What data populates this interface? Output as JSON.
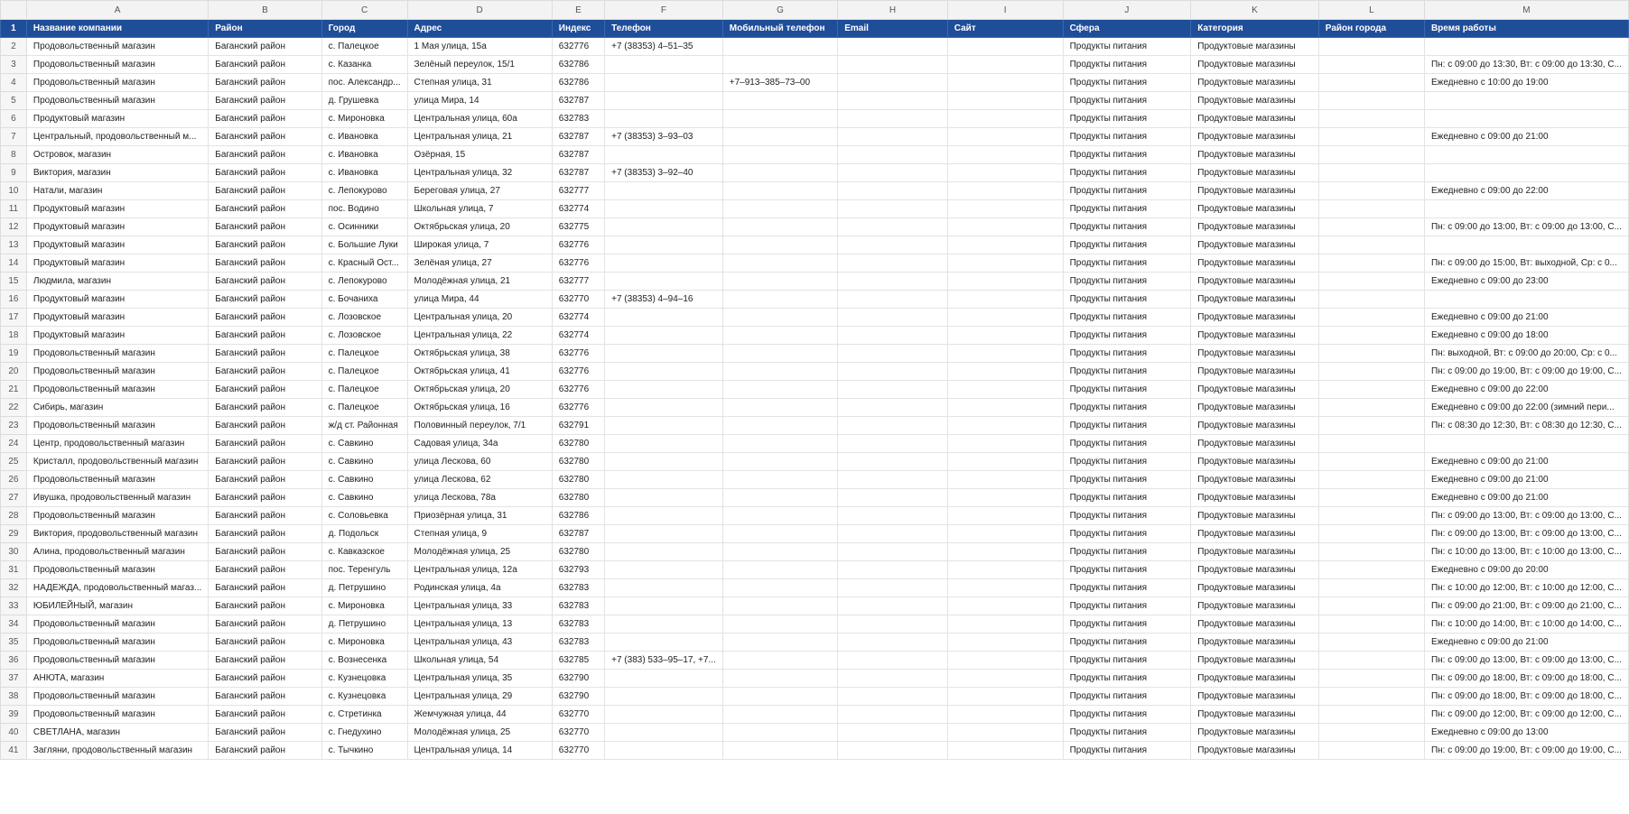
{
  "columns": [
    "A",
    "B",
    "C",
    "D",
    "E",
    "F",
    "G",
    "H",
    "I",
    "J",
    "K",
    "L",
    "M"
  ],
  "header_row_number": "1",
  "headers": [
    "Название компании",
    "Район",
    "Город",
    "Адрес",
    "Индекс",
    "Телефон",
    "Мобильный телефон",
    "Email",
    "Сайт",
    "Сфера",
    "Категория",
    "Район города",
    "Время работы"
  ],
  "rows": [
    {
      "n": "2",
      "c": [
        "Продовольственный магазин",
        "Баганский район",
        "с. Палецкое",
        "1 Мая улица, 15а",
        "632776",
        "+7 (38353) 4‒51‒35",
        "",
        "",
        "",
        "Продукты питания",
        "Продуктовые магазины",
        "",
        ""
      ]
    },
    {
      "n": "3",
      "c": [
        "Продовольственный магазин",
        "Баганский район",
        "с. Казанка",
        "Зелёный переулок, 15/1",
        "632786",
        "",
        "",
        "",
        "",
        "Продукты питания",
        "Продуктовые магазины",
        "",
        "Пн: с 09:00 до 13:30, Вт: с 09:00 до 13:30, С..."
      ]
    },
    {
      "n": "4",
      "c": [
        "Продовольственный магазин",
        "Баганский район",
        "пос. Александр...",
        "Степная улица, 31",
        "632786",
        "",
        "+7‒913‒385‒73‒00",
        "",
        "",
        "Продукты питания",
        "Продуктовые магазины",
        "",
        "Ежедневно с 10:00 до 19:00"
      ]
    },
    {
      "n": "5",
      "c": [
        "Продовольственный магазин",
        "Баганский район",
        "д. Грушевка",
        "улица Мира, 14",
        "632787",
        "",
        "",
        "",
        "",
        "Продукты питания",
        "Продуктовые магазины",
        "",
        ""
      ]
    },
    {
      "n": "6",
      "c": [
        "Продуктовый магазин",
        "Баганский район",
        "с. Миронoвка",
        "Центральная улица, 60а",
        "632783",
        "",
        "",
        "",
        "",
        "Продукты питания",
        "Продуктовые магазины",
        "",
        ""
      ]
    },
    {
      "n": "7",
      "c": [
        "Центральный, продовольственный м...",
        "Баганский район",
        "с. Ивановка",
        "Центральная улица, 21",
        "632787",
        "+7 (38353) 3‒93‒03",
        "",
        "",
        "",
        "Продукты питания",
        "Продуктовые магазины",
        "",
        "Ежедневно с 09:00 до 21:00"
      ]
    },
    {
      "n": "8",
      "c": [
        "Островок, магазин",
        "Баганский район",
        "с. Ивановка",
        "Озёрная, 15",
        "632787",
        "",
        "",
        "",
        "",
        "Продукты питания",
        "Продуктовые магазины",
        "",
        ""
      ]
    },
    {
      "n": "9",
      "c": [
        "Виктория, магазин",
        "Баганский район",
        "с. Ивановка",
        "Центральная улица, 32",
        "632787",
        "+7 (38353) 3‒92‒40",
        "",
        "",
        "",
        "Продукты питания",
        "Продуктовые магазины",
        "",
        ""
      ]
    },
    {
      "n": "10",
      "c": [
        "Натали, магазин",
        "Баганский район",
        "с. Лепокурово",
        "Береговая улица, 27",
        "632777",
        "",
        "",
        "",
        "",
        "Продукты питания",
        "Продуктовые магазины",
        "",
        "Ежедневно с 09:00 до 22:00"
      ]
    },
    {
      "n": "11",
      "c": [
        "Продуктовый магазин",
        "Баганский район",
        "пос. Водино",
        "Школьная улица, 7",
        "632774",
        "",
        "",
        "",
        "",
        "Продукты питания",
        "Продуктовые магазины",
        "",
        ""
      ]
    },
    {
      "n": "12",
      "c": [
        "Продуктовый магазин",
        "Баганский район",
        "с. Осинники",
        "Октябрьская улица, 20",
        "632775",
        "",
        "",
        "",
        "",
        "Продукты питания",
        "Продуктовые магазины",
        "",
        "Пн: с 09:00 до 13:00, Вт: с 09:00 до 13:00, С..."
      ]
    },
    {
      "n": "13",
      "c": [
        "Продуктовый магазин",
        "Баганский район",
        "с. Большие Луки",
        "Широкая улица, 7",
        "632776",
        "",
        "",
        "",
        "",
        "Продукты питания",
        "Продуктовые магазины",
        "",
        ""
      ]
    },
    {
      "n": "14",
      "c": [
        "Продуктовый магазин",
        "Баганский район",
        "с. Красный Ост...",
        "Зелёная улица, 27",
        "632776",
        "",
        "",
        "",
        "",
        "Продукты питания",
        "Продуктовые магазины",
        "",
        "Пн: с 09:00 до 15:00, Вт: выходной, Ср: с 0..."
      ]
    },
    {
      "n": "15",
      "c": [
        "Людмила, магазин",
        "Баганский район",
        "с. Лепокурово",
        "Молодёжная улица, 21",
        "632777",
        "",
        "",
        "",
        "",
        "Продукты питания",
        "Продуктовые магазины",
        "",
        "Ежедневно с 09:00 до 23:00"
      ]
    },
    {
      "n": "16",
      "c": [
        "Продуктовый магазин",
        "Баганский район",
        "с. Бочаниха",
        "улица Мира, 44",
        "632770",
        "+7 (38353) 4‒94‒16",
        "",
        "",
        "",
        "Продукты питания",
        "Продуктовые магазины",
        "",
        ""
      ]
    },
    {
      "n": "17",
      "c": [
        "Продуктовый магазин",
        "Баганский район",
        "с. Лозовское",
        "Центральная улица, 20",
        "632774",
        "",
        "",
        "",
        "",
        "Продукты питания",
        "Продуктовые магазины",
        "",
        "Ежедневно с 09:00 до 21:00"
      ]
    },
    {
      "n": "18",
      "c": [
        "Продуктовый магазин",
        "Баганский район",
        "с. Лозовское",
        "Центральная улица, 22",
        "632774",
        "",
        "",
        "",
        "",
        "Продукты питания",
        "Продуктовые магазины",
        "",
        "Ежедневно с 09:00 до 18:00"
      ]
    },
    {
      "n": "19",
      "c": [
        "Продовольственный магазин",
        "Баганский район",
        "с. Палецкое",
        "Октябрьская улица, 38",
        "632776",
        "",
        "",
        "",
        "",
        "Продукты питания",
        "Продуктовые магазины",
        "",
        "Пн: выходной, Вт: с 09:00 до 20:00, Ср: с 0..."
      ]
    },
    {
      "n": "20",
      "c": [
        "Продовольственный магазин",
        "Баганский район",
        "с. Палецкое",
        "Октябрьская улица, 41",
        "632776",
        "",
        "",
        "",
        "",
        "Продукты питания",
        "Продуктовые магазины",
        "",
        "Пн: с 09:00 до 19:00, Вт: с 09:00 до 19:00, С..."
      ]
    },
    {
      "n": "21",
      "c": [
        "Продовольственный магазин",
        "Баганский район",
        "с. Палецкое",
        "Октябрьская улица, 20",
        "632776",
        "",
        "",
        "",
        "",
        "Продукты питания",
        "Продуктовые магазины",
        "",
        "Ежедневно с 09:00 до 22:00"
      ]
    },
    {
      "n": "22",
      "c": [
        "Сибирь, магазин",
        "Баганский район",
        "с. Палецкое",
        "Октябрьская улица, 16",
        "632776",
        "",
        "",
        "",
        "",
        "Продукты питания",
        "Продуктовые магазины",
        "",
        "Ежедневно с 09:00 до 22:00 (зимний пери..."
      ]
    },
    {
      "n": "23",
      "c": [
        "Продовольственный магазин",
        "Баганский район",
        "ж/д ст. Районная",
        "Половинный переулок, 7/1",
        "632791",
        "",
        "",
        "",
        "",
        "Продукты питания",
        "Продуктовые магазины",
        "",
        "Пн: с 08:30 до 12:30, Вт: с 08:30 до 12:30, С..."
      ]
    },
    {
      "n": "24",
      "c": [
        "Центр, продовольственный магазин",
        "Баганский район",
        "с. Савкино",
        "Садовая улица, 34а",
        "632780",
        "",
        "",
        "",
        "",
        "Продукты питания",
        "Продуктовые магазины",
        "",
        ""
      ]
    },
    {
      "n": "25",
      "c": [
        "Кристалл, продовольственный магазин",
        "Баганский район",
        "с. Савкино",
        "улица Лескова, 60",
        "632780",
        "",
        "",
        "",
        "",
        "Продукты питания",
        "Продуктовые магазины",
        "",
        "Ежедневно с 09:00 до 21:00"
      ]
    },
    {
      "n": "26",
      "c": [
        "Продовольственный магазин",
        "Баганский район",
        "с. Савкино",
        "улица Лескова, 62",
        "632780",
        "",
        "",
        "",
        "",
        "Продукты питания",
        "Продуктовые магазины",
        "",
        "Ежедневно с 09:00 до 21:00"
      ]
    },
    {
      "n": "27",
      "c": [
        "Ивушка, продовольственный магазин",
        "Баганский район",
        "с. Савкино",
        "улица Лескова, 78а",
        "632780",
        "",
        "",
        "",
        "",
        "Продукты питания",
        "Продуктовые магазины",
        "",
        "Ежедневно с 09:00 до 21:00"
      ]
    },
    {
      "n": "28",
      "c": [
        "Продовольственный магазин",
        "Баганский район",
        "с. Соловьевка",
        "Приозёрная улица, 31",
        "632786",
        "",
        "",
        "",
        "",
        "Продукты питания",
        "Продуктовые магазины",
        "",
        "Пн: с 09:00 до 13:00, Вт: с 09:00 до 13:00, С..."
      ]
    },
    {
      "n": "29",
      "c": [
        "Виктория, продовольственный магазин",
        "Баганский район",
        "д. Подольск",
        "Степная улица, 9",
        "632787",
        "",
        "",
        "",
        "",
        "Продукты питания",
        "Продуктовые магазины",
        "",
        "Пн: с 09:00 до 13:00, Вт: с 09:00 до 13:00, С..."
      ]
    },
    {
      "n": "30",
      "c": [
        "Алина, продовольственный магазин",
        "Баганский район",
        "с. Кавказское",
        "Молодёжная улица, 25",
        "632780",
        "",
        "",
        "",
        "",
        "Продукты питания",
        "Продуктовые магазины",
        "",
        "Пн: с 10:00 до 13:00, Вт: с 10:00 до 13:00, С..."
      ]
    },
    {
      "n": "31",
      "c": [
        "Продовольственный магазин",
        "Баганский район",
        "пос. Теренгуль",
        "Центральная улица, 12а",
        "632793",
        "",
        "",
        "",
        "",
        "Продукты питания",
        "Продуктовые магазины",
        "",
        "Ежедневно с 09:00 до 20:00"
      ]
    },
    {
      "n": "32",
      "c": [
        "НАДЕЖДА, продовольственный магаз...",
        "Баганский район",
        "д. Петрушино",
        "Родинская улица, 4а",
        "632783",
        "",
        "",
        "",
        "",
        "Продукты питания",
        "Продуктовые магазины",
        "",
        "Пн: с 10:00 до 12:00, Вт: с 10:00 до 12:00, С..."
      ]
    },
    {
      "n": "33",
      "c": [
        "ЮБИЛЕЙНЫЙ, магазин",
        "Баганский район",
        "с. Миронoвка",
        "Центральная улица, 33",
        "632783",
        "",
        "",
        "",
        "",
        "Продукты питания",
        "Продуктовые магазины",
        "",
        "Пн: с 09:00 до 21:00, Вт: с 09:00 до 21:00, С..."
      ]
    },
    {
      "n": "34",
      "c": [
        "Продовольственный магазин",
        "Баганский район",
        "д. Петрушино",
        "Центральная улица, 13",
        "632783",
        "",
        "",
        "",
        "",
        "Продукты питания",
        "Продуктовые магазины",
        "",
        "Пн: с 10:00 до 14:00, Вт: с 10:00 до 14:00, С..."
      ]
    },
    {
      "n": "35",
      "c": [
        "Продовольственный магазин",
        "Баганский район",
        "с. Миронoвка",
        "Центральная улица, 43",
        "632783",
        "",
        "",
        "",
        "",
        "Продукты питания",
        "Продуктовые магазины",
        "",
        "Ежедневно с 09:00 до 21:00"
      ]
    },
    {
      "n": "36",
      "c": [
        "Продовольственный магазин",
        "Баганский район",
        "с. Вознесенка",
        "Школьная улица, 54",
        "632785",
        "+7 (383) 533‒95‒17, +7...",
        "",
        "",
        "",
        "Продукты питания",
        "Продуктовые магазины",
        "",
        "Пн: с 09:00 до 13:00, Вт: с 09:00 до 13:00, С..."
      ]
    },
    {
      "n": "37",
      "c": [
        "АНЮТА, магазин",
        "Баганский район",
        "с. Кузнецовка",
        "Центральная улица, 35",
        "632790",
        "",
        "",
        "",
        "",
        "Продукты питания",
        "Продуктовые магазины",
        "",
        "Пн: с 09:00 до 18:00, Вт: с 09:00 до 18:00, С..."
      ]
    },
    {
      "n": "38",
      "c": [
        "Продовольственный магазин",
        "Баганский район",
        "с. Кузнецовка",
        "Центральная улица, 29",
        "632790",
        "",
        "",
        "",
        "",
        "Продукты питания",
        "Продуктовые магазины",
        "",
        "Пн: с 09:00 до 18:00, Вт: с 09:00 до 18:00, С..."
      ]
    },
    {
      "n": "39",
      "c": [
        "Продовольственный магазин",
        "Баганский район",
        "с. Стретинка",
        "Жемчужная улица, 44",
        "632770",
        "",
        "",
        "",
        "",
        "Продукты питания",
        "Продуктовые магазины",
        "",
        "Пн: с 09:00 до 12:00, Вт: с 09:00 до 12:00, С..."
      ]
    },
    {
      "n": "40",
      "c": [
        "СВЕТЛАНА, магазин",
        "Баганский район",
        "с. Гнедухино",
        "Молодёжная улица, 25",
        "632770",
        "",
        "",
        "",
        "",
        "Продукты питания",
        "Продуктовые магазины",
        "",
        "Ежедневно с 09:00 до 13:00"
      ]
    },
    {
      "n": "41",
      "c": [
        "Загляни, продовольственный магазин",
        "Баганский район",
        "с. Тычкино",
        "Центральная улица, 14",
        "632770",
        "",
        "",
        "",
        "",
        "Продукты питания",
        "Продуктовые магазины",
        "",
        "Пн: с 09:00 до 19:00, Вт: с 09:00 до 19:00, С..."
      ]
    }
  ]
}
